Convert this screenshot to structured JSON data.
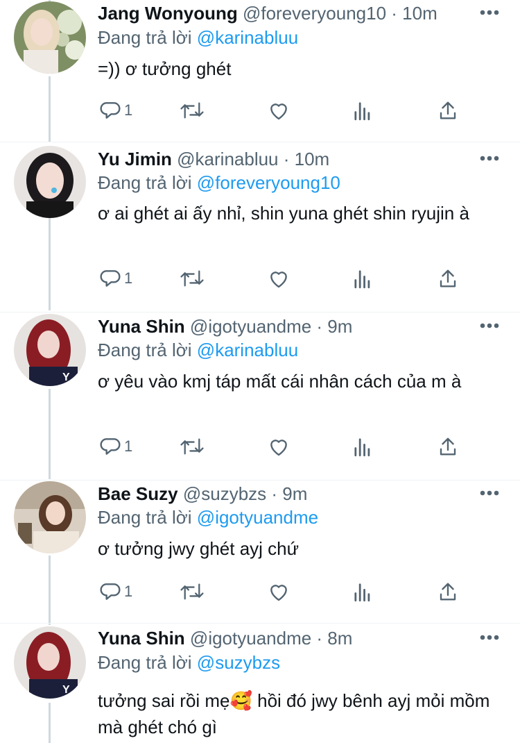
{
  "colors": {
    "link": "#1d9bf0",
    "muted": "#536471",
    "text": "#0f1419",
    "thread": "#cfd9de"
  },
  "tweets": [
    {
      "name": "Jang Wonyoung",
      "meta": "@foreveryoung10 · 10m",
      "reply_prefix": "Đang trả lời",
      "reply_handle": "@karinabluu",
      "text": "=)) ơ tưởng ghét",
      "reply_count": "1",
      "avatar_icon": "profile-photo-blonde-flowers"
    },
    {
      "name": "Yu Jimin",
      "meta": "@karinabluu · 10m",
      "reply_prefix": "Đang trả lời",
      "reply_handle": "@foreveryoung10",
      "text": "ơ ai ghét ai ấy nhỉ, shin yuna ghét shin ryujin à",
      "reply_count": "1",
      "avatar_icon": "profile-photo-dark-hair"
    },
    {
      "name": "Yuna Shin",
      "meta": "@igotyuandme · 9m",
      "reply_prefix": "Đang trả lời",
      "reply_handle": "@karinabluu",
      "text": "ơ yêu vào kmj táp mất cái nhân cách của m à",
      "reply_count": "1",
      "avatar_icon": "profile-photo-red-hair"
    },
    {
      "name": "Bae Suzy",
      "meta": "@suzybzs · 9m",
      "reply_prefix": "Đang trả lời",
      "reply_handle": "@igotyuandme",
      "text": "ơ tưởng jwy ghét ayj chứ",
      "reply_count": "1",
      "avatar_icon": "profile-photo-cafe"
    },
    {
      "name": "Yuna Shin",
      "meta": "@igotyuandme · 8m",
      "reply_prefix": "Đang trả lời",
      "reply_handle": "@suzybzs",
      "text": "tưởng sai rồi mẹ🥰  hồi đó jwy bênh ayj mỏi mồm mà ghét chó gì",
      "reply_count": "",
      "avatar_icon": "profile-photo-red-hair"
    }
  ]
}
